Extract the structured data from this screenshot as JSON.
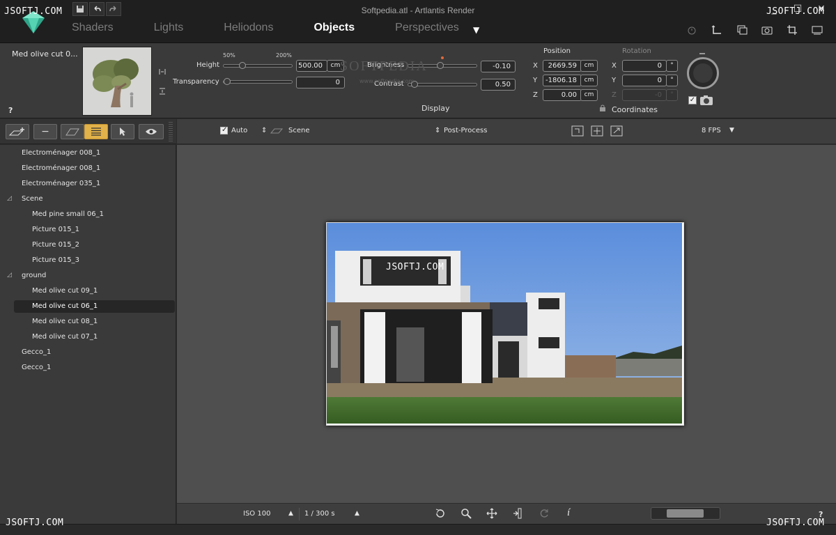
{
  "window": {
    "title": "Softpedia.atl - Artlantis Render"
  },
  "nav": {
    "tabs": [
      {
        "label": "Shaders"
      },
      {
        "label": "Lights"
      },
      {
        "label": "Heliodons"
      },
      {
        "label": "Objects"
      },
      {
        "label": "Perspectives"
      }
    ],
    "active": "Objects"
  },
  "object": {
    "name": "Med olive cut 0...",
    "help": "?",
    "scale_min_label": "50%",
    "scale_max_label": "200%",
    "height_label": "Height",
    "height_value": "500.00",
    "height_unit": "cm",
    "height_level": 0.24,
    "transparency_label": "Transparency",
    "transparency_value": "0",
    "transparency_level": 0.0
  },
  "display": {
    "brightness_label": "Brightness",
    "brightness_value": "-0.10",
    "brightness_level": 0.45,
    "contrast_label": "Contrast",
    "contrast_value": "0.50",
    "contrast_level": 0.04,
    "section_label": "Display"
  },
  "position": {
    "title": "Position",
    "x_label": "X",
    "x_value": "2669.59",
    "y_label": "Y",
    "y_value": "-1806.18",
    "z_label": "Z",
    "z_value": "0.00",
    "unit": "cm"
  },
  "rotation": {
    "title": "Rotation",
    "x_label": "X",
    "x_value": "0",
    "y_label": "Y",
    "y_value": "0",
    "z_label": "Z",
    "z_value": "-0",
    "unit": "°"
  },
  "coordinates": {
    "label": "Coordinates"
  },
  "tree": {
    "items": [
      {
        "label": "Electroménager 008_1",
        "level": 0
      },
      {
        "label": "Electroménager 008_1",
        "level": 0
      },
      {
        "label": "Electroménager 035_1",
        "level": 0
      },
      {
        "label": "Scene",
        "level": 0,
        "group": true
      },
      {
        "label": "Med pine small 06_1",
        "level": 1
      },
      {
        "label": "Picture 015_1",
        "level": 1
      },
      {
        "label": "Picture 015_2",
        "level": 1
      },
      {
        "label": "Picture 015_3",
        "level": 1
      },
      {
        "label": "ground",
        "level": 0,
        "group": true
      },
      {
        "label": "Med olive cut 09_1",
        "level": 1
      },
      {
        "label": "Med olive cut 06_1",
        "level": 1,
        "selected": true
      },
      {
        "label": "Med olive cut 08_1",
        "level": 1
      },
      {
        "label": "Med olive cut 07_1",
        "level": 1
      },
      {
        "label": "Gecco_1",
        "level": 0
      },
      {
        "label": "Gecco_1",
        "level": 0
      }
    ]
  },
  "viewport": {
    "auto_label": "Auto",
    "auto_checked": true,
    "scene_label": "Scene",
    "postprocess_label": "Post-Process",
    "fps_label": "8  FPS",
    "render_watermark": "JSOFTJ.COM"
  },
  "bottom": {
    "iso_label": "ISO  100",
    "shutter_label": "1 /  300 s",
    "help": "?"
  },
  "watermarks": {
    "top_left": "JSOFTJ.COM",
    "top_right": "JSOFTJ.COM",
    "bottom_left": "JSOFTJ.COM",
    "bottom_right": "JSOFTJ.COM",
    "softpedia": "SOFTPEDIA",
    "softpedia_url": "www.softpedia.com"
  },
  "colors": {
    "accent_on": "#e2b24a",
    "logo": "#3fbf9f",
    "sky": "#5d8fd8",
    "grass": "#3f6a2a"
  }
}
